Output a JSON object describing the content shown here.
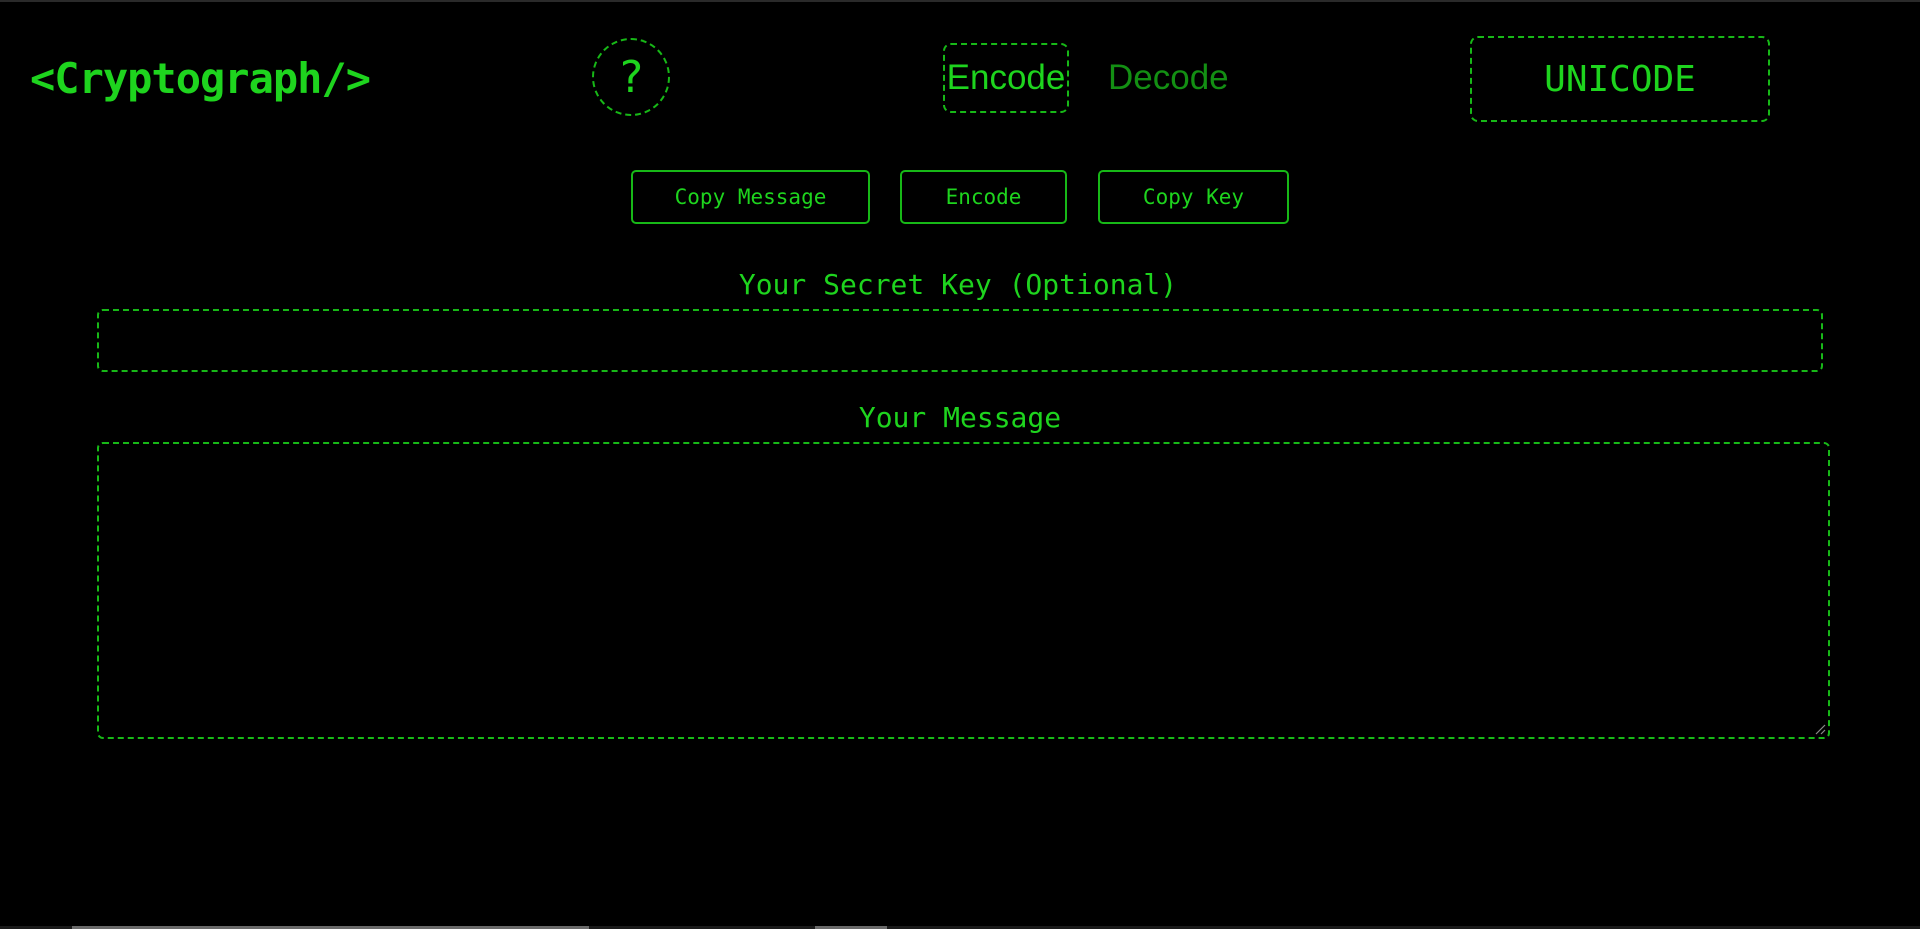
{
  "header": {
    "logo": "<Cryptograph/>",
    "help_label": "?",
    "mode_tabs": {
      "encode": "Encode",
      "decode": "Decode"
    },
    "charset_label": "UNICODE"
  },
  "actions": {
    "copy_message": "Copy Message",
    "encode": "Encode",
    "copy_key": "Copy Key"
  },
  "form": {
    "key_label": "Your Secret Key (Optional)",
    "key_value": "",
    "message_label": "Your Message",
    "message_value": ""
  },
  "colors": {
    "background": "#000000",
    "accent": "#1ed41e",
    "accent_dim": "#138f13"
  },
  "icons": {
    "help": "question-mark-icon",
    "resize": "resize-grip-icon"
  }
}
